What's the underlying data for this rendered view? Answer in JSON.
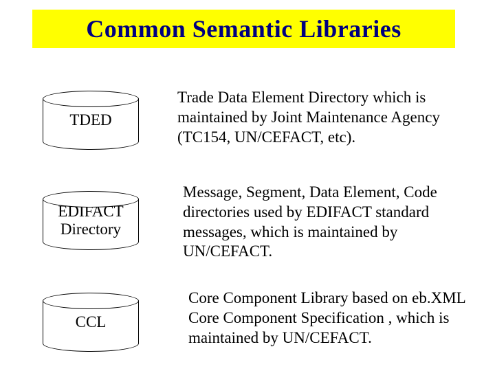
{
  "title": "Common Semantic Libraries",
  "items": [
    {
      "label": "TDED",
      "description": "Trade Data Element Directory which is maintained by Joint Maintenance Agency (TC154, UN/CEFACT, etc)."
    },
    {
      "label": "EDIFACT Directory",
      "description": "Message, Segment, Data Element, Code directories used by EDIFACT standard messages, which is maintained by UN/CEFACT."
    },
    {
      "label": "CCL",
      "description": "Core Component Library based on eb.XML Core Component Specification , which is maintained by UN/CEFACT."
    }
  ]
}
